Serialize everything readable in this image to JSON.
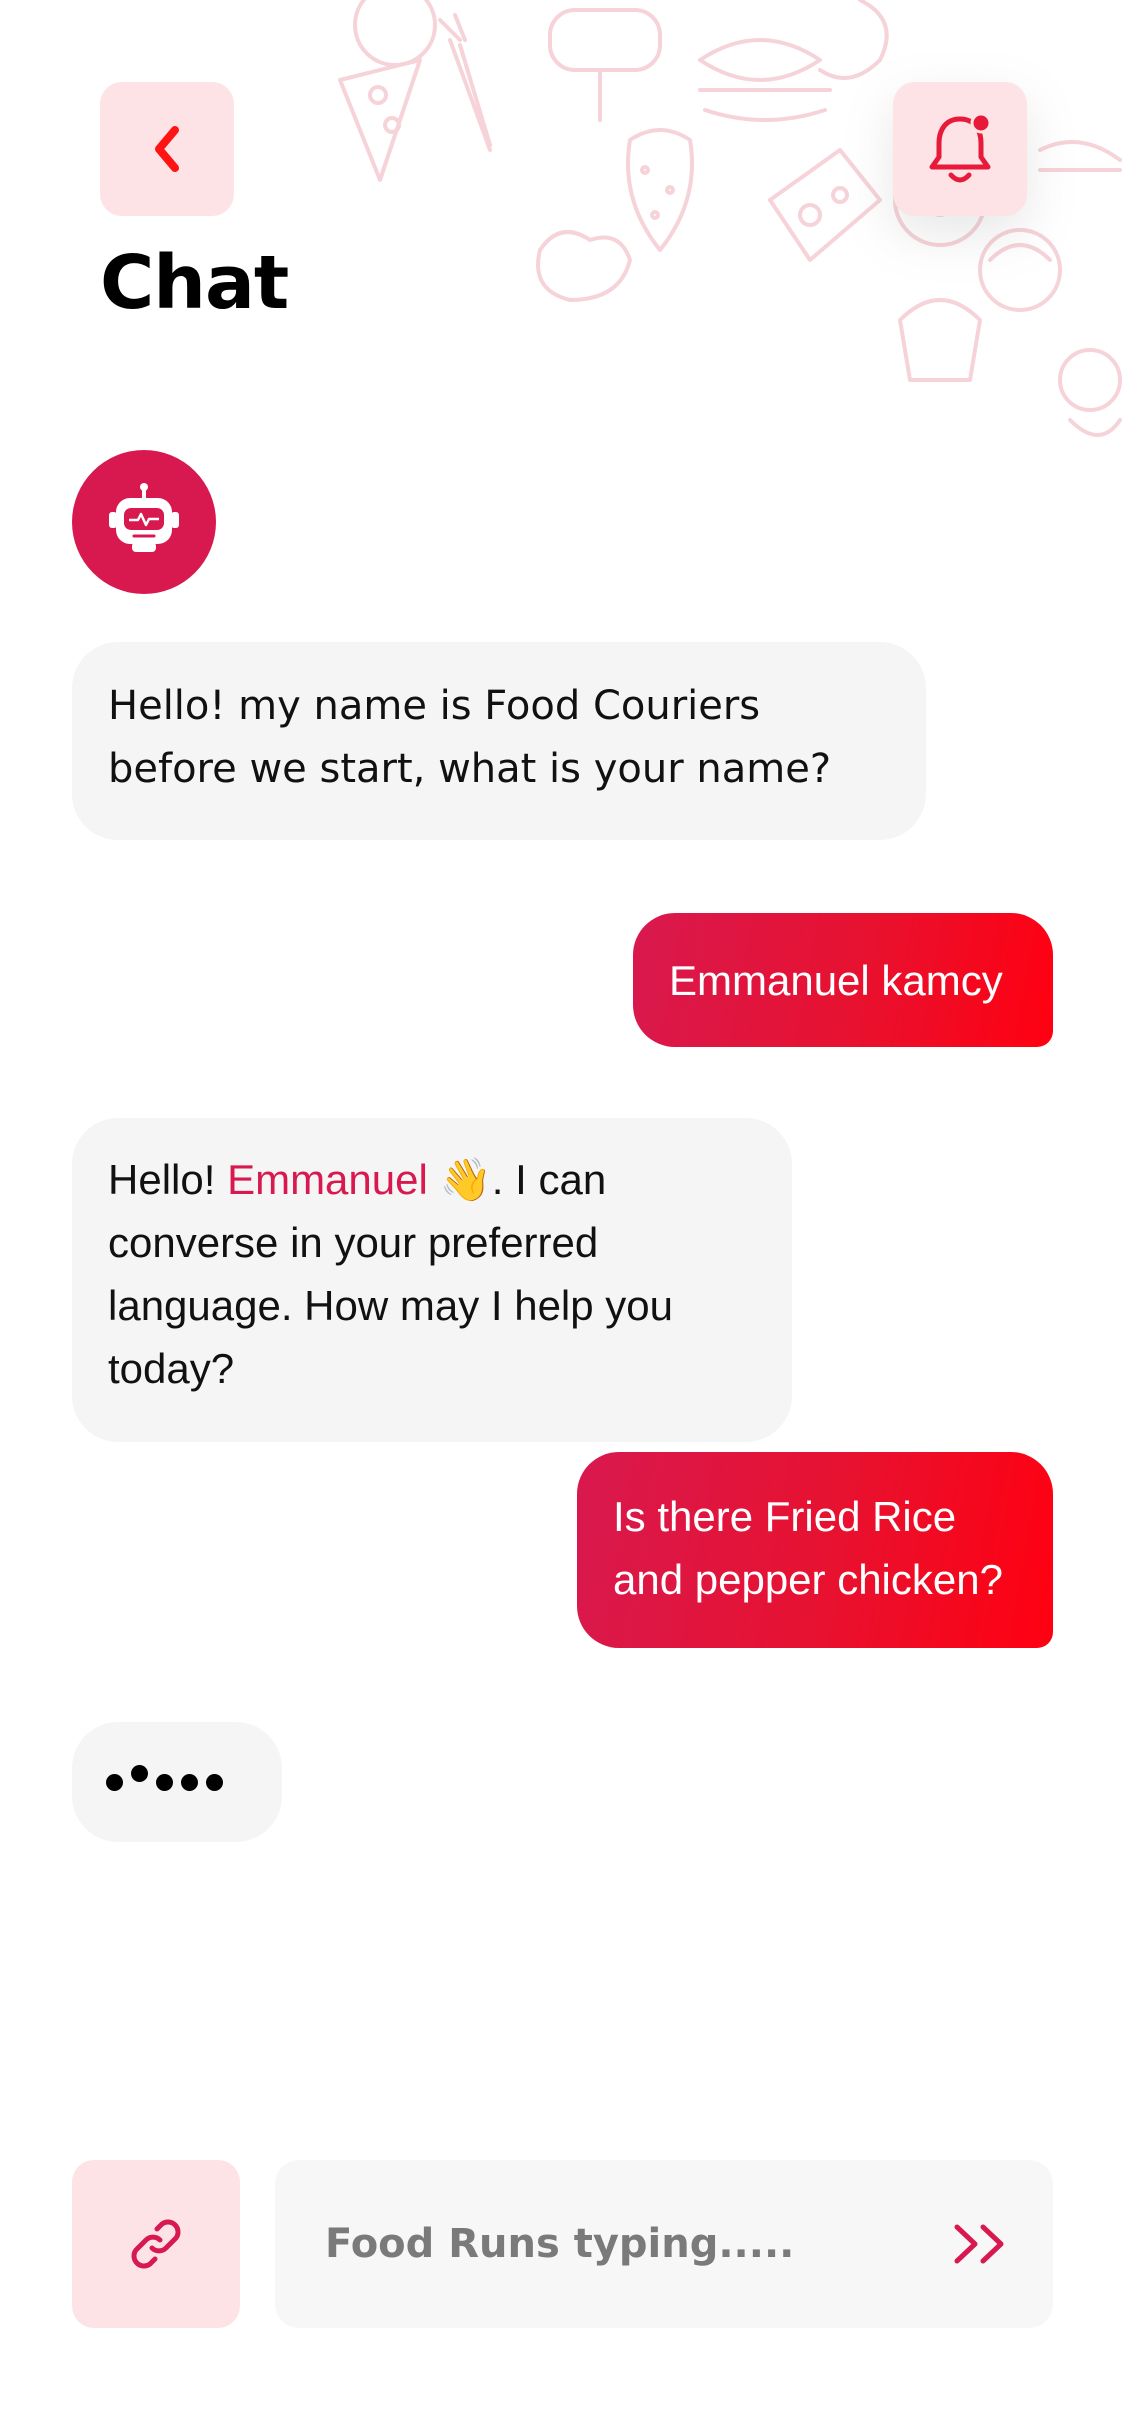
{
  "header": {
    "title": "Chat",
    "back_icon": "chevron-left-icon",
    "notification_icon": "bell-icon",
    "has_unread": true
  },
  "messages": [
    {
      "from": "bot",
      "text": "Hello! my name is Food Couriers before we start, what is your name?"
    },
    {
      "from": "user",
      "text": "Emmanuel kamcy"
    },
    {
      "from": "bot",
      "text_before": "Hello! ",
      "highlight": "Emmanuel",
      "emoji": "👋",
      "text_after": ". I can converse in your preferred language. How may I help you today?"
    },
    {
      "from": "user",
      "text": "Is there Fried Rice and pepper chicken?"
    }
  ],
  "typing_indicator": {
    "dots": 5
  },
  "composer": {
    "attach_icon": "link-icon",
    "placeholder": "Food Runs typing.....",
    "send_icon": "double-chevron-right-icon"
  },
  "colors": {
    "accent": "#d8194f",
    "accent_red": "#ff0010",
    "soft_pink": "#fde3e5",
    "bot_bubble": "#f5f5f5"
  }
}
